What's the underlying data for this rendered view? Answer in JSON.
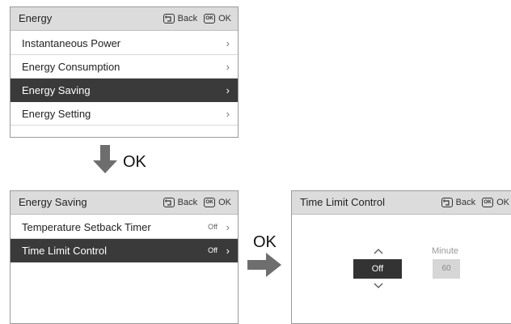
{
  "screen1": {
    "title": "Energy",
    "back_label": "Back",
    "ok_label": "OK",
    "ok_icon_text": "OK",
    "items": [
      {
        "label": "Instantaneous Power"
      },
      {
        "label": "Energy Consumption"
      },
      {
        "label": "Energy Saving",
        "selected": true
      },
      {
        "label": "Energy Setting"
      }
    ]
  },
  "transition1": {
    "label": "OK"
  },
  "screen2": {
    "title": "Energy Saving",
    "back_label": "Back",
    "ok_label": "OK",
    "ok_icon_text": "OK",
    "items": [
      {
        "label": "Temperature Setback Timer",
        "value": "Off"
      },
      {
        "label": "Time Limit Control",
        "value": "Off",
        "selected": true
      }
    ]
  },
  "transition2": {
    "label": "OK"
  },
  "screen3": {
    "title": "Time Limit Control",
    "back_label": "Back",
    "ok_label": "OK",
    "ok_icon_text": "OK",
    "toggle_value": "Off",
    "minute_label": "Minute",
    "minute_value": "60"
  },
  "icons": {
    "chevron": "›",
    "up": "chevron-up-icon",
    "down": "chevron-down-icon",
    "back": "back-icon",
    "ok": "ok-icon"
  },
  "colors": {
    "header_bg": "#dcdcdc",
    "selected_bg": "#3a3a3a",
    "arrow": "#6e6e6e"
  }
}
